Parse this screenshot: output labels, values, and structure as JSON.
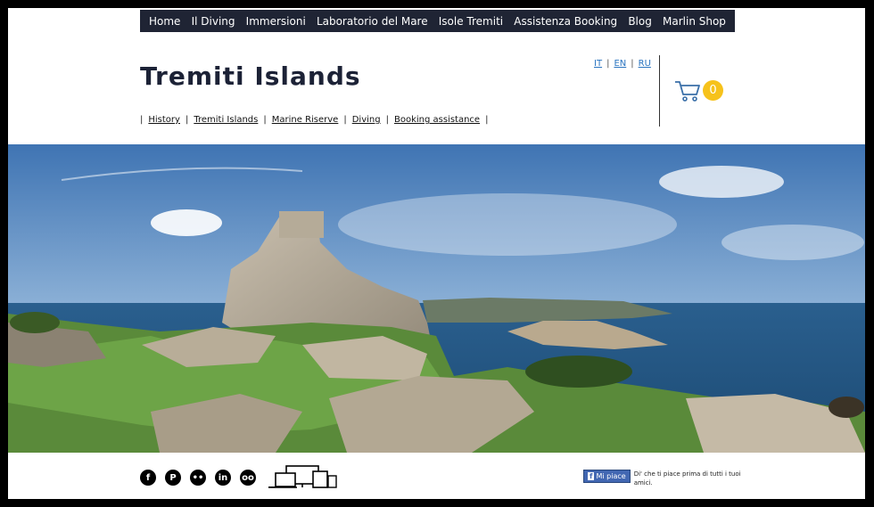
{
  "nav": {
    "items": [
      "Home",
      "Il Diving",
      "Immersioni",
      "Laboratorio del Mare",
      "Isole Tremiti",
      "Assistenza Booking",
      "Blog",
      "Marlin Shop"
    ]
  },
  "header": {
    "title": "Tremiti Islands"
  },
  "languages": [
    "IT",
    "EN",
    "RU"
  ],
  "cart": {
    "count": "0"
  },
  "breadcrumb": {
    "items": [
      "History",
      "Tremiti Islands",
      "Marine Riserve",
      "Diving",
      "Booking assistance"
    ]
  },
  "footer": {
    "social": [
      "facebook-icon",
      "pinterest-icon",
      "flickr-icon",
      "linkedin-icon",
      "tripadvisor-icon"
    ],
    "fb_like_label": "Mi piace",
    "fb_like_text": "Di' che ti piace prima di tutti i tuoi amici."
  },
  "colors": {
    "nav_bg": "#1f2434",
    "title": "#1c2236",
    "cart_badge": "#f6c21b",
    "link_blue": "#2a74c0"
  }
}
